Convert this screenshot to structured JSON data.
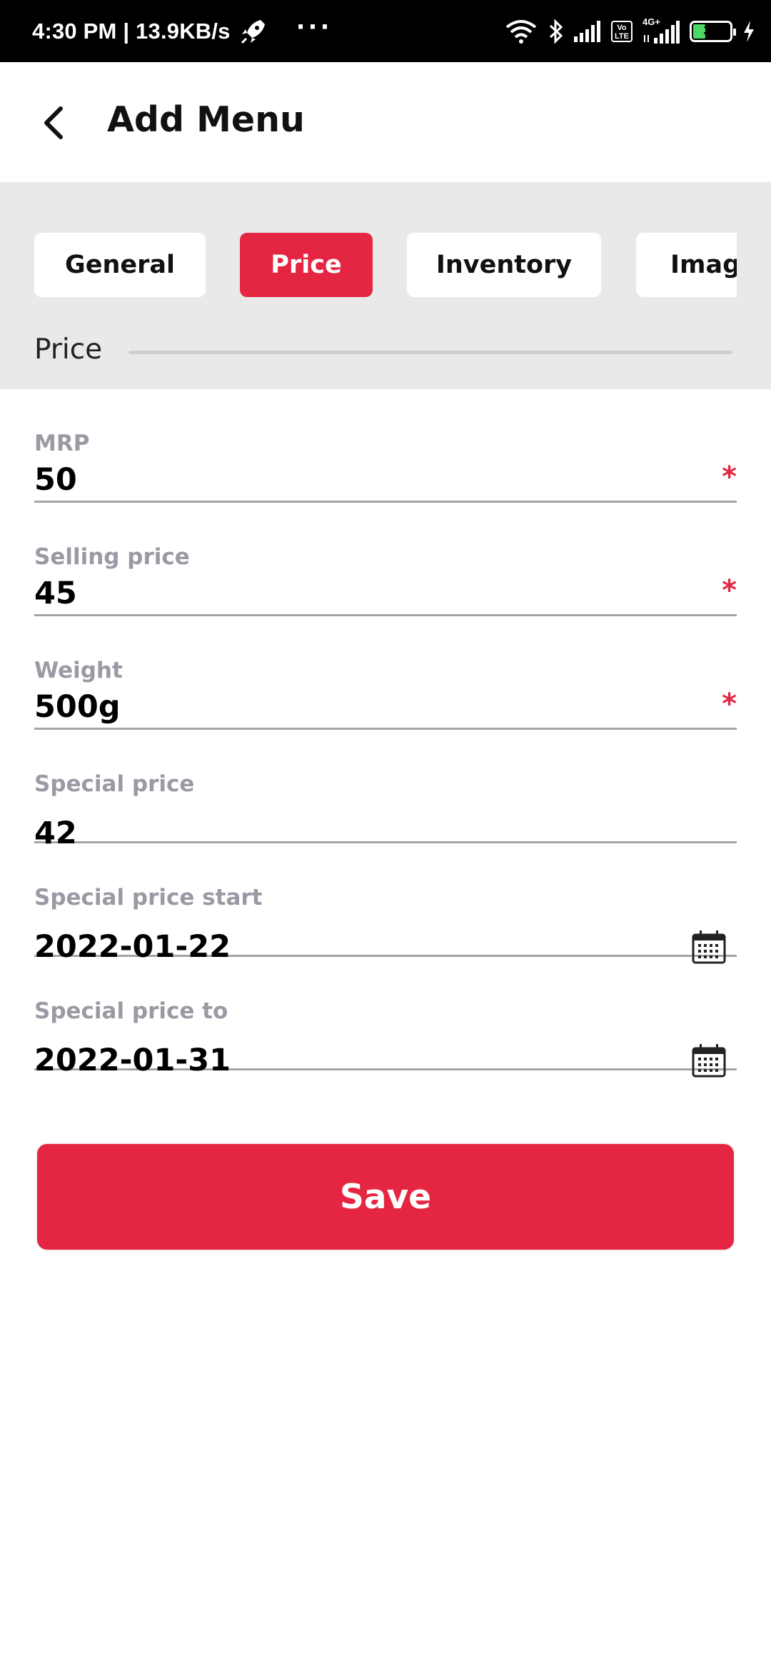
{
  "status_bar": {
    "time_speed": "4:30 PM | 13.9KB/s",
    "more": "···",
    "network_4g": "4G+",
    "volte_top": "Vo",
    "volte_bottom": "LTE",
    "battery": "31",
    "battery_level": 0.31
  },
  "header": {
    "title": "Add Menu"
  },
  "tabs": [
    {
      "label": "General"
    },
    {
      "label": "Price"
    },
    {
      "label": "Inventory"
    },
    {
      "label": "Images"
    }
  ],
  "active_tab": "Price",
  "section": {
    "label": "Price"
  },
  "form": {
    "mrp": {
      "label": "MRP",
      "value": "50",
      "required": "*"
    },
    "selling_price": {
      "label": "Selling price",
      "value": "45",
      "required": "*"
    },
    "weight": {
      "label": "Weight",
      "value": "500g",
      "required": "*"
    },
    "special_price": {
      "label": "Special price",
      "value": "42"
    },
    "special_price_start": {
      "label": "Special price start",
      "value": "2022-01-22"
    },
    "special_price_to": {
      "label": "Special price to",
      "value": "2022-01-31"
    }
  },
  "save_button": {
    "label": "Save"
  },
  "colors": {
    "accent": "#e52642",
    "label": "#9a9aa4",
    "tab_bg": "#e9e9e9",
    "divider": "#a3a3ab"
  }
}
